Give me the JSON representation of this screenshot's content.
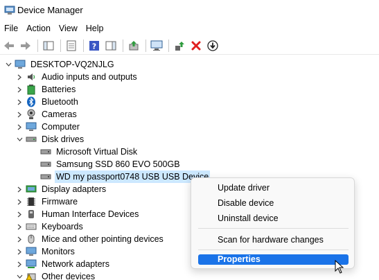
{
  "window": {
    "title": "Device Manager"
  },
  "menu": [
    "File",
    "Action",
    "View",
    "Help"
  ],
  "tree": {
    "root": "DESKTOP-VQ2NJLG",
    "items": [
      {
        "label": "Audio inputs and outputs",
        "icon": "speaker-icon"
      },
      {
        "label": "Batteries",
        "icon": "battery-icon"
      },
      {
        "label": "Bluetooth",
        "icon": "bluetooth-icon"
      },
      {
        "label": "Cameras",
        "icon": "camera-icon"
      },
      {
        "label": "Computer",
        "icon": "monitor-icon"
      },
      {
        "label": "Disk drives",
        "icon": "disk-drive-icon"
      },
      {
        "label": "Microsoft Virtual Disk",
        "icon": "disk-icon"
      },
      {
        "label": "Samsung SSD 860 EVO 500GB",
        "icon": "disk-icon"
      },
      {
        "label": "WD my passport0748 USB USB Device",
        "icon": "disk-icon"
      },
      {
        "label": "Display adapters",
        "icon": "display-adapter-icon"
      },
      {
        "label": "Firmware",
        "icon": "firmware-icon"
      },
      {
        "label": "Human Interface Devices",
        "icon": "hid-icon"
      },
      {
        "label": "Keyboards",
        "icon": "keyboard-icon"
      },
      {
        "label": "Mice and other pointing devices",
        "icon": "mouse-icon"
      },
      {
        "label": "Monitors",
        "icon": "monitor-icon"
      },
      {
        "label": "Network adapters",
        "icon": "network-icon"
      },
      {
        "label": "Other devices",
        "icon": "other-devices-icon"
      }
    ]
  },
  "context_menu": {
    "update_driver": "Update driver",
    "disable_device": "Disable device",
    "uninstall_device": "Uninstall device",
    "scan": "Scan for hardware changes",
    "properties": "Properties"
  },
  "colors": {
    "selection": "#cce8ff",
    "accent": "#1a73e8"
  }
}
